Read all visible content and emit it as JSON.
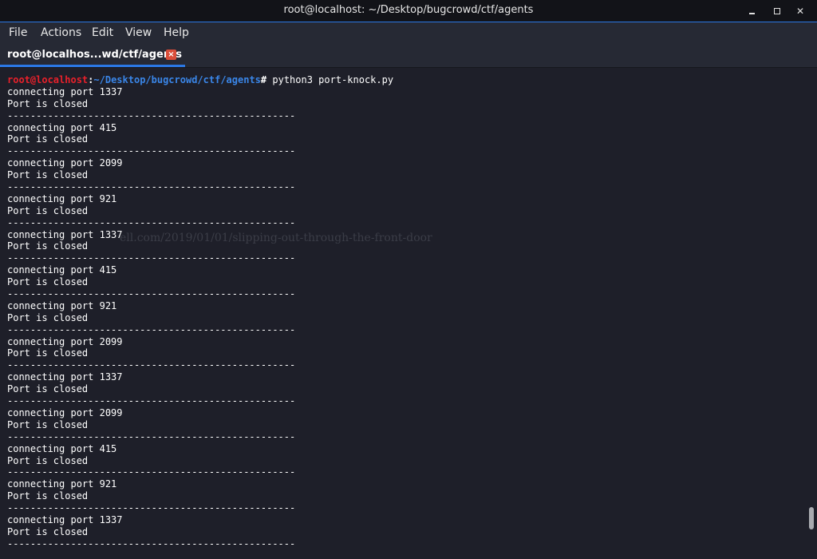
{
  "window": {
    "title": "root@localhost: ~/Desktop/bugcrowd/ctf/agents",
    "minimize_label": "minimize",
    "maximize_label": "maximize",
    "close_label": "close"
  },
  "menu": {
    "items": [
      "File",
      "Actions",
      "Edit",
      "View",
      "Help"
    ]
  },
  "tab": {
    "label": "root@localhos...wd/ctf/agents",
    "close_glyph": "×"
  },
  "terminal": {
    "prompt": {
      "user_host": "root@localhost",
      "separator": ":",
      "path": "~/Desktop/bugcrowd/ctf/agents",
      "symbol": "#",
      "command": " python3 port-knock.py"
    },
    "separator_line": "--------------------------------------------------",
    "blocks": [
      {
        "connect": "connecting port 1337",
        "status": "Port is closed"
      },
      {
        "connect": "connecting port 415",
        "status": "Port is closed"
      },
      {
        "connect": "connecting port 2099",
        "status": "Port is closed"
      },
      {
        "connect": "connecting port 921",
        "status": "Port is closed"
      },
      {
        "connect": "connecting port 1337",
        "status": "Port is closed"
      },
      {
        "connect": "connecting port 415",
        "status": "Port is closed"
      },
      {
        "connect": "connecting port 921",
        "status": "Port is closed"
      },
      {
        "connect": "connecting port 2099",
        "status": "Port is closed"
      },
      {
        "connect": "connecting port 1337",
        "status": "Port is closed"
      },
      {
        "connect": "connecting port 2099",
        "status": "Port is closed"
      },
      {
        "connect": "connecting port 415",
        "status": "Port is closed"
      },
      {
        "connect": "connecting port 921",
        "status": "Port is closed"
      },
      {
        "connect": "connecting port 1337",
        "status": "Port is closed"
      }
    ],
    "watermark": "ell.com/2019/01/01/slipping-out-through-the-front-door"
  },
  "colors": {
    "background": "#1e1f29",
    "titlebar": "#121318",
    "accent": "#2b78e4",
    "prompt_user": "#e8202a",
    "prompt_path": "#3a86e8",
    "tab_close": "#d94d3a"
  }
}
